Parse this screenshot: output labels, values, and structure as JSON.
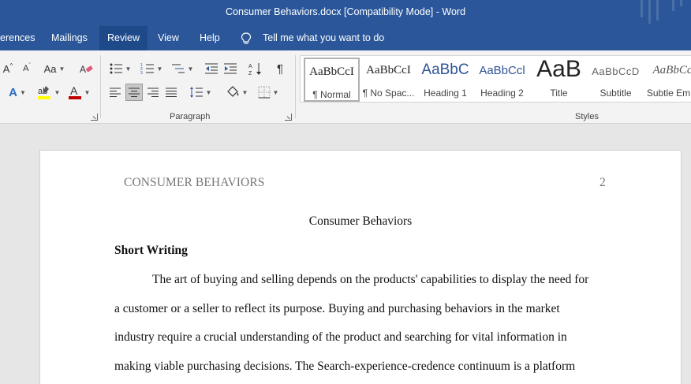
{
  "window": {
    "title": "Consumer Behaviors.docx [Compatibility Mode]  -  Word"
  },
  "tabs": [
    {
      "label": "erences"
    },
    {
      "label": "Mailings"
    },
    {
      "label": "Review"
    },
    {
      "label": "View"
    },
    {
      "label": "Help"
    }
  ],
  "active_tab": "Review",
  "tell_me": "Tell me what you want to do",
  "ribbon": {
    "font_group": {
      "change_case_label": "Aa"
    },
    "paragraph_group": {
      "label": "Paragraph"
    },
    "styles_group": {
      "label": "Styles",
      "items": [
        {
          "sample": "AaBbCcI",
          "name": "¶ Normal"
        },
        {
          "sample": "AaBbCcI",
          "name": "¶ No Spac..."
        },
        {
          "sample": "AaBbC",
          "name": "Heading 1"
        },
        {
          "sample": "AaBbCcl",
          "name": "Heading 2"
        },
        {
          "sample": "AaB",
          "name": "Title"
        },
        {
          "sample": "AaBbCcD",
          "name": "Subtitle"
        },
        {
          "sample": "AaBbCc",
          "name": "Subtle Em..."
        }
      ]
    },
    "colors": {
      "highlight": "#ffff00",
      "font_color": "#c00000",
      "accent": "#2b579a"
    }
  },
  "document": {
    "header_left": "CONSUMER BEHAVIORS",
    "page_number": "2",
    "title": "Consumer Behaviors",
    "heading": "Short Writing",
    "lines": [
      "The art of buying and selling depends on the products' capabilities to display the need for",
      "a customer or a seller to reflect its purpose. Buying and purchasing behaviors in the market",
      "industry require a crucial understanding of the product and searching for vital information in",
      "making viable purchasing decisions. The Search-experience-credence continuum is a platform"
    ]
  }
}
